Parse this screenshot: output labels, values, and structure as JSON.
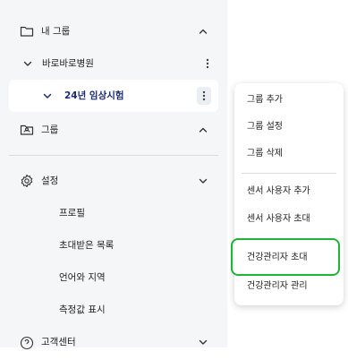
{
  "sidebar": {
    "my_groups": {
      "label": "내 그룹",
      "icon": "folder-icon"
    },
    "hospital": {
      "label": "바로바로병원"
    },
    "trial": {
      "label": "24년 임상시험"
    },
    "groups": {
      "label": "그룹",
      "icon": "shared-folder-icon"
    },
    "settings": {
      "label": "설정",
      "items": [
        {
          "label": "프로필"
        },
        {
          "label": "초대받은 목록"
        },
        {
          "label": "언어와 지역"
        },
        {
          "label": "측정값 표시"
        }
      ]
    },
    "support": {
      "label": "고객센터"
    }
  },
  "context_menu": {
    "items": [
      {
        "label": "그룹 추가"
      },
      {
        "label": "그룹 설정"
      },
      {
        "label": "그룹 삭제"
      },
      {
        "label": "센서 사용자 추가"
      },
      {
        "label": "센서 사용자 초대"
      },
      {
        "label": "건강관리자 초대"
      },
      {
        "label": "건강관리자 관리"
      }
    ],
    "highlighted_index": 5
  },
  "colors": {
    "sidebar_bg": "#f5f6f8",
    "selected_text": "#1b2b78",
    "highlight_border": "#1fb33a"
  }
}
